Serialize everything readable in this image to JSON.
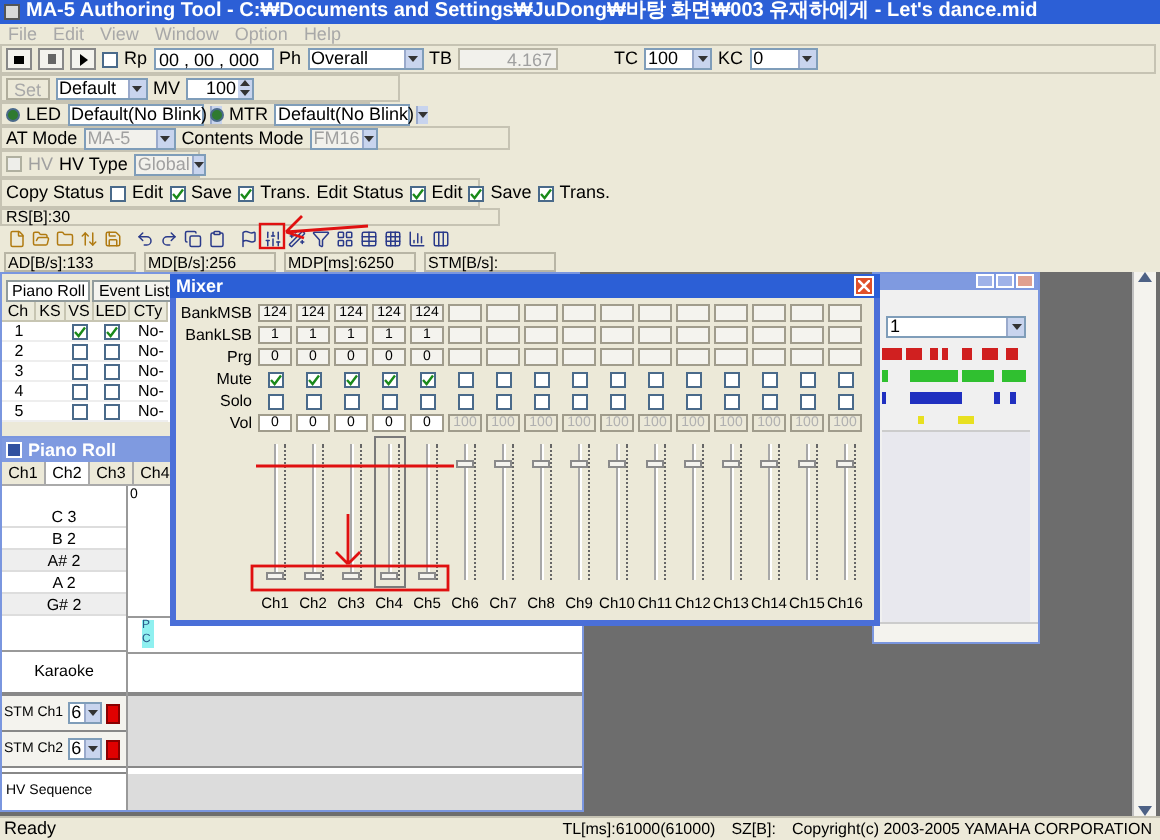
{
  "window": {
    "title": "MA-5 Authoring Tool - C:₩Documents and Settings₩JuDong₩바탕 화면₩003 유재하에게 - Let's dance.mid"
  },
  "menu": [
    {
      "label": "File",
      "disabled": true
    },
    {
      "label": "Edit",
      "disabled": true
    },
    {
      "label": "View",
      "disabled": true
    },
    {
      "label": "Window",
      "disabled": true
    },
    {
      "label": "Option",
      "disabled": true
    },
    {
      "label": "Help",
      "disabled": true
    }
  ],
  "transport": {
    "rp": {
      "label": "Rp",
      "checked": false
    },
    "position": "00 , 00 , 000",
    "ph": {
      "label": "Ph",
      "value": "Overall"
    },
    "tb": {
      "label": "TB",
      "value": "4.167",
      "disabled": true
    },
    "tc": {
      "label": "TC",
      "value": "100"
    },
    "kc": {
      "label": "KC",
      "value": "0"
    }
  },
  "preset": {
    "set": {
      "label": "Set",
      "disabled": true
    },
    "value": "Default",
    "mv": {
      "label": "MV",
      "value": "100"
    }
  },
  "led": {
    "label": "LED",
    "value": "Default(No Blink)",
    "selected": true
  },
  "mtr": {
    "label": "MTR",
    "value": "Default(No Blink)",
    "selected": true
  },
  "at_mode": {
    "label": "AT Mode",
    "value": "MA-5",
    "disabled": true
  },
  "contents_mode": {
    "label": "Contents Mode",
    "value": "FM16",
    "disabled": true
  },
  "hv": {
    "label": "HV",
    "checked": false,
    "disabled": true
  },
  "hv_type": {
    "label": "HV Type",
    "value": "Global",
    "disabled": true
  },
  "copy_status": {
    "label": "Copy Status",
    "options": [
      {
        "label": "Edit",
        "checked": false
      },
      {
        "label": "Save",
        "checked": true
      },
      {
        "label": "Trans.",
        "checked": true
      }
    ]
  },
  "edit_status": {
    "label": "Edit Status",
    "options": [
      {
        "label": "Edit",
        "checked": true
      },
      {
        "label": "Save",
        "checked": true
      },
      {
        "label": "Trans.",
        "checked": true
      }
    ]
  },
  "rs": "RS[B]:30",
  "rates": [
    "AD[B/s]:133",
    "MD[B/s]:256",
    "MDP[ms]:6250",
    "STM[B/s]:"
  ],
  "event_window": {
    "tabs": [
      {
        "label": "Piano Roll",
        "selected": true
      },
      {
        "label": "Event List",
        "selected": false
      }
    ],
    "columns": [
      "Ch",
      "KS",
      "VS",
      "LED",
      "CTy"
    ],
    "rows": [
      {
        "ch": "1",
        "vs": true,
        "led": true,
        "cty": "No-"
      },
      {
        "ch": "2",
        "vs": false,
        "led": false,
        "cty": "No-"
      },
      {
        "ch": "3",
        "vs": false,
        "led": false,
        "cty": "No-"
      },
      {
        "ch": "4",
        "vs": false,
        "led": false,
        "cty": "No-"
      },
      {
        "ch": "5",
        "vs": false,
        "led": false,
        "cty": "No-"
      }
    ]
  },
  "piano_roll": {
    "title": "Piano Roll",
    "tabs": [
      {
        "label": "Ch1",
        "selected": false
      },
      {
        "label": "Ch2",
        "selected": true
      },
      {
        "label": "Ch3",
        "selected": false
      },
      {
        "label": "Ch4",
        "selected": false
      }
    ],
    "marker": "0",
    "notes": [
      "C 3",
      "B 2",
      "A# 2",
      "A 2",
      "G# 2"
    ],
    "pc_marker": "PC",
    "karaoke": "Karaoke",
    "stm": [
      {
        "label": "STM Ch1",
        "value": "6",
        "color": "#e00000"
      },
      {
        "label": "STM Ch2",
        "value": "6",
        "color": "#e00000"
      }
    ],
    "hv_sequence": "HV Sequence"
  },
  "mixer": {
    "title": "Mixer",
    "row_labels": [
      "BankMSB",
      "BankLSB",
      "Prg",
      "Mute",
      "Solo",
      "Vol"
    ],
    "channels": [
      {
        "label": "Ch1",
        "bank_msb": "124",
        "bank_lsb": "1",
        "prg": "0",
        "mute": true,
        "solo": false,
        "vol": "0",
        "level": 0.04,
        "disabled": false,
        "selected": false
      },
      {
        "label": "Ch2",
        "bank_msb": "124",
        "bank_lsb": "1",
        "prg": "0",
        "mute": true,
        "solo": false,
        "vol": "0",
        "level": 0.04,
        "disabled": false,
        "selected": false
      },
      {
        "label": "Ch3",
        "bank_msb": "124",
        "bank_lsb": "1",
        "prg": "0",
        "mute": true,
        "solo": false,
        "vol": "0",
        "level": 0.04,
        "disabled": false,
        "selected": false
      },
      {
        "label": "Ch4",
        "bank_msb": "124",
        "bank_lsb": "1",
        "prg": "0",
        "mute": true,
        "solo": false,
        "vol": "0",
        "level": 0.04,
        "disabled": false,
        "selected": true
      },
      {
        "label": "Ch5",
        "bank_msb": "124",
        "bank_lsb": "1",
        "prg": "0",
        "mute": true,
        "solo": false,
        "vol": "0",
        "level": 0.04,
        "disabled": false,
        "selected": false
      },
      {
        "label": "Ch6",
        "mute": false,
        "solo": false,
        "vol": "100",
        "level": 0.82,
        "disabled": true,
        "selected": false
      },
      {
        "label": "Ch7",
        "mute": false,
        "solo": false,
        "vol": "100",
        "level": 0.82,
        "disabled": true,
        "selected": false
      },
      {
        "label": "Ch8",
        "mute": false,
        "solo": false,
        "vol": "100",
        "level": 0.82,
        "disabled": true,
        "selected": false
      },
      {
        "label": "Ch9",
        "mute": false,
        "solo": false,
        "vol": "100",
        "level": 0.82,
        "disabled": true,
        "selected": false
      },
      {
        "label": "Ch10",
        "mute": false,
        "solo": false,
        "vol": "100",
        "level": 0.82,
        "disabled": true,
        "selected": false
      },
      {
        "label": "Ch11",
        "mute": false,
        "solo": false,
        "vol": "100",
        "level": 0.82,
        "disabled": true,
        "selected": false
      },
      {
        "label": "Ch12",
        "mute": false,
        "solo": false,
        "vol": "100",
        "level": 0.82,
        "disabled": true,
        "selected": false
      },
      {
        "label": "Ch13",
        "mute": false,
        "solo": false,
        "vol": "100",
        "level": 0.82,
        "disabled": true,
        "selected": false
      },
      {
        "label": "Ch14",
        "mute": false,
        "solo": false,
        "vol": "100",
        "level": 0.82,
        "disabled": true,
        "selected": false
      },
      {
        "label": "Ch15",
        "mute": false,
        "solo": false,
        "vol": "100",
        "level": 0.82,
        "disabled": true,
        "selected": false
      },
      {
        "label": "Ch16",
        "mute": false,
        "solo": false,
        "vol": "100",
        "level": 0.82,
        "disabled": true,
        "selected": false
      }
    ]
  },
  "track_window": {
    "selector": "1"
  },
  "status_bar": {
    "message": "Ready",
    "fields": [
      "TL[ms]:61000(61000)",
      "SZ[B]:",
      "Copyright(c) 2003-2005 YAMAHA CORPORATION"
    ]
  }
}
